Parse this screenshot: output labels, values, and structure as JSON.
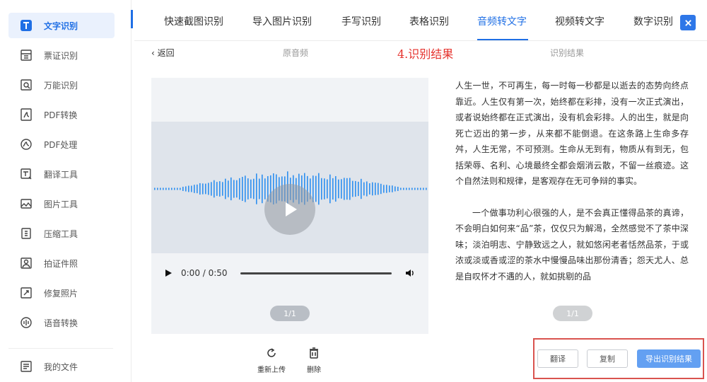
{
  "sidebar": {
    "items": [
      {
        "label": "文字识别",
        "icon": "text-recognition-icon",
        "active": true
      },
      {
        "label": "票证识别",
        "icon": "ticket-icon"
      },
      {
        "label": "万能识别",
        "icon": "universal-scan-icon"
      },
      {
        "label": "PDF转换",
        "icon": "pdf-convert-icon"
      },
      {
        "label": "PDF处理",
        "icon": "pdf-process-icon"
      },
      {
        "label": "翻译工具",
        "icon": "translate-icon"
      },
      {
        "label": "图片工具",
        "icon": "image-tool-icon"
      },
      {
        "label": "压缩工具",
        "icon": "compress-icon"
      },
      {
        "label": "拍证件照",
        "icon": "id-photo-icon"
      },
      {
        "label": "修复照片",
        "icon": "repair-photo-icon"
      },
      {
        "label": "语音转换",
        "icon": "voice-convert-icon"
      }
    ],
    "my_files": {
      "label": "我的文件",
      "icon": "my-files-icon"
    }
  },
  "tabs": [
    {
      "label": "快速截图识别"
    },
    {
      "label": "导入图片识别"
    },
    {
      "label": "手写识别"
    },
    {
      "label": "表格识别"
    },
    {
      "label": "音频转文字",
      "active": true
    },
    {
      "label": "视频转文字"
    },
    {
      "label": "数字识别"
    }
  ],
  "subheader": {
    "back": "‹ 返回",
    "original_audio": "原音频",
    "step_annotation": "4.识别结果",
    "result_title": "识别结果"
  },
  "player": {
    "time": "0:00 / 0:50",
    "pager": "1/1"
  },
  "result": {
    "paragraphs": [
      "人生一世，不可再生，每一时每一秒都是以逝去的态势向终点靠近。人生仅有第一次，始终都在彩排，没有一次正式演出，或者说始终都在正式演出，没有机会彩排。人的出生，就是向死亡迈出的第一步，从来都不能倒退。在这条路上生命多存舛，人生无常，不可预测。生命从无到有，物质从有到无，包括荣辱、名利、心境最终全都会烟消云散，不留一丝痕迹。这个自然法则和规律，是客观存在无可争辩的事实。",
      "一个做事功利心很强的人，是不会真正懂得品茶的真谛，不会明白如何来“品”茶，仅仅只为解渴，全然感觉不了茶中深味；淡泊明志、宁静致远之人，就如悠闲老者恬然品茶，于或浓或淡或香或涩的茶水中慢慢品味出那份清香；怨天尤人、总是自叹怀才不遇的人，就如挑剔的品"
    ],
    "pager": "1/1"
  },
  "actions": {
    "reupload": "重新上传",
    "delete": "删除",
    "translate": "翻译",
    "copy": "复制",
    "export": "导出识别结果"
  },
  "colors": {
    "accent": "#1f6fe5",
    "annotation_red": "#e5322d",
    "export_button": "#63a0f2",
    "wave": "#2d8ff0"
  }
}
